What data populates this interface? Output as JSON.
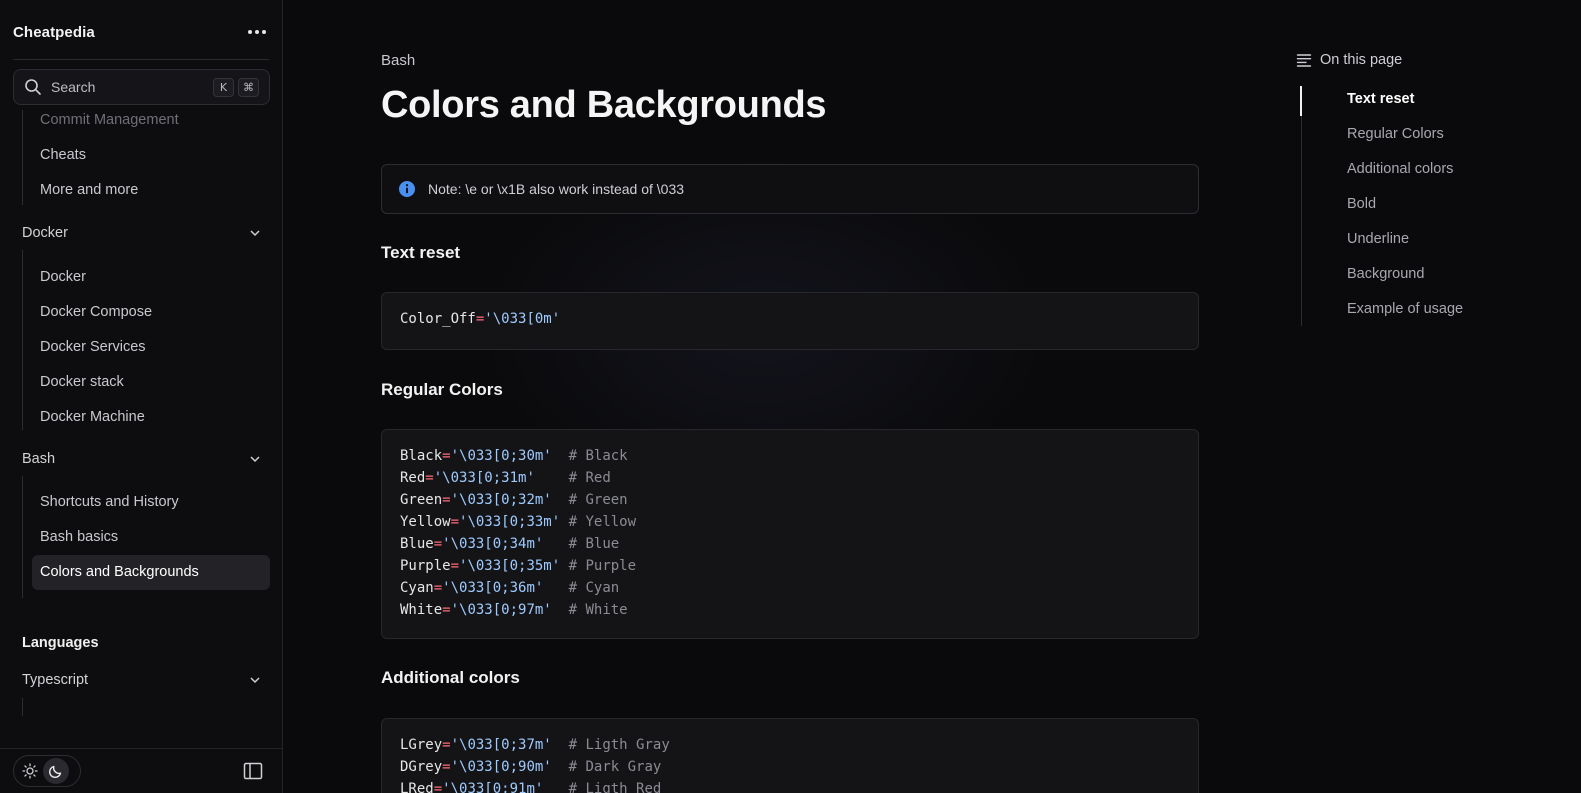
{
  "brand": "Cheatpedia",
  "search": {
    "label": "Search",
    "kbd": [
      "K",
      "⌘"
    ]
  },
  "nav": {
    "git_items": [
      "Commit Management",
      "Cheats",
      "More and more"
    ],
    "docker": {
      "label": "Docker",
      "items": [
        "Docker",
        "Docker Compose",
        "Docker Services",
        "Docker stack",
        "Docker Machine"
      ]
    },
    "bash": {
      "label": "Bash",
      "items": [
        "Shortcuts and History",
        "Bash basics",
        "Colors and Backgrounds"
      ]
    },
    "languages_title": "Languages",
    "typescript": {
      "label": "Typescript"
    }
  },
  "page": {
    "breadcrumb": "Bash",
    "title": "Colors and Backgrounds",
    "note": "Note: \\e or \\x1B also work instead of \\033"
  },
  "sections": [
    {
      "title": "Text reset",
      "lines": [
        {
          "key": "Color_Off",
          "val": "'\\033[0m'",
          "comment": ""
        }
      ]
    },
    {
      "title": "Regular Colors",
      "lines": [
        {
          "key": "Black",
          "val": "'\\033[0;30m'",
          "pad": "  ",
          "comment": "# Black"
        },
        {
          "key": "Red",
          "val": "'\\033[0;31m'",
          "pad": "    ",
          "comment": "# Red"
        },
        {
          "key": "Green",
          "val": "'\\033[0;32m'",
          "pad": "  ",
          "comment": "# Green"
        },
        {
          "key": "Yellow",
          "val": "'\\033[0;33m'",
          "pad": " ",
          "comment": "# Yellow"
        },
        {
          "key": "Blue",
          "val": "'\\033[0;34m'",
          "pad": "   ",
          "comment": "# Blue"
        },
        {
          "key": "Purple",
          "val": "'\\033[0;35m'",
          "pad": " ",
          "comment": "# Purple"
        },
        {
          "key": "Cyan",
          "val": "'\\033[0;36m'",
          "pad": "   ",
          "comment": "# Cyan"
        },
        {
          "key": "White",
          "val": "'\\033[0;97m'",
          "pad": "  ",
          "comment": "# White"
        }
      ]
    },
    {
      "title": "Additional colors",
      "lines": [
        {
          "key": "LGrey",
          "val": "'\\033[0;37m'",
          "pad": "  ",
          "comment": "# Ligth Gray"
        },
        {
          "key": "DGrey",
          "val": "'\\033[0;90m'",
          "pad": "  ",
          "comment": "# Dark Gray"
        },
        {
          "key": "LRed",
          "val": "'\\033[0;91m'",
          "pad": "   ",
          "comment": "# Ligth Red"
        }
      ]
    }
  ],
  "toc": {
    "title": "On this page",
    "items": [
      "Text reset",
      "Regular Colors",
      "Additional colors",
      "Bold",
      "Underline",
      "Background",
      "Example of usage"
    ],
    "active": "Text reset"
  },
  "colors": {
    "accent_info": "#4a90f0",
    "string": "#9ecbff",
    "operator": "#ff6b7a",
    "comment": "#8b8b94"
  }
}
